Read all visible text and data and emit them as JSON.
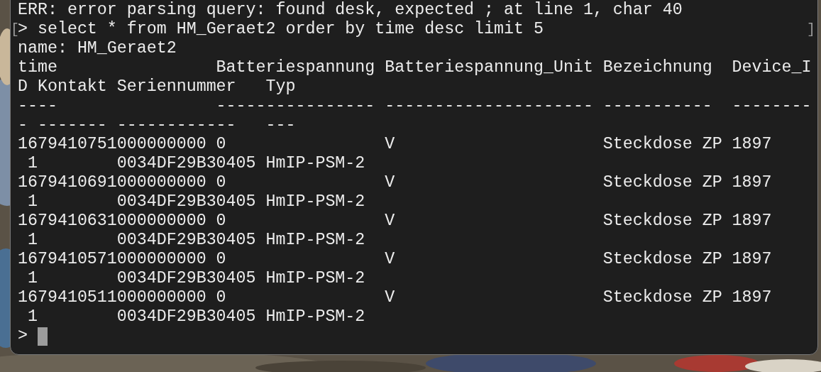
{
  "terminal": {
    "lines": [
      {
        "text": "ERR: error parsing query: found desk, expected ; at line 1, char 40"
      },
      {
        "text": "> select * from HM_Geraet2 order by time desc limit 5",
        "mark_left": "[",
        "mark_right": "]"
      },
      {
        "text": "name: HM_Geraet2"
      },
      {
        "text": "time                Batteriespannung Batteriespannung_Unit Bezeichnung  Device_I"
      },
      {
        "text": "D Kontakt Seriennummer   Typ"
      },
      {
        "text": "----                ---------------- --------------------- -----------  --------"
      },
      {
        "text": "- ------- ------------   ---"
      },
      {
        "text": "1679410751000000000 0                V                     Steckdose ZP 1897"
      },
      {
        "text": " 1        0034DF29B30405 HmIP-PSM-2"
      },
      {
        "text": "1679410691000000000 0                V                     Steckdose ZP 1897"
      },
      {
        "text": " 1        0034DF29B30405 HmIP-PSM-2"
      },
      {
        "text": "1679410631000000000 0                V                     Steckdose ZP 1897"
      },
      {
        "text": " 1        0034DF29B30405 HmIP-PSM-2"
      },
      {
        "text": "1679410571000000000 0                V                     Steckdose ZP 1897"
      },
      {
        "text": " 1        0034DF29B30405 HmIP-PSM-2"
      },
      {
        "text": "1679410511000000000 0                V                     Steckdose ZP 1897"
      },
      {
        "text": " 1        0034DF29B30405 HmIP-PSM-2"
      }
    ],
    "prompt": ">"
  }
}
